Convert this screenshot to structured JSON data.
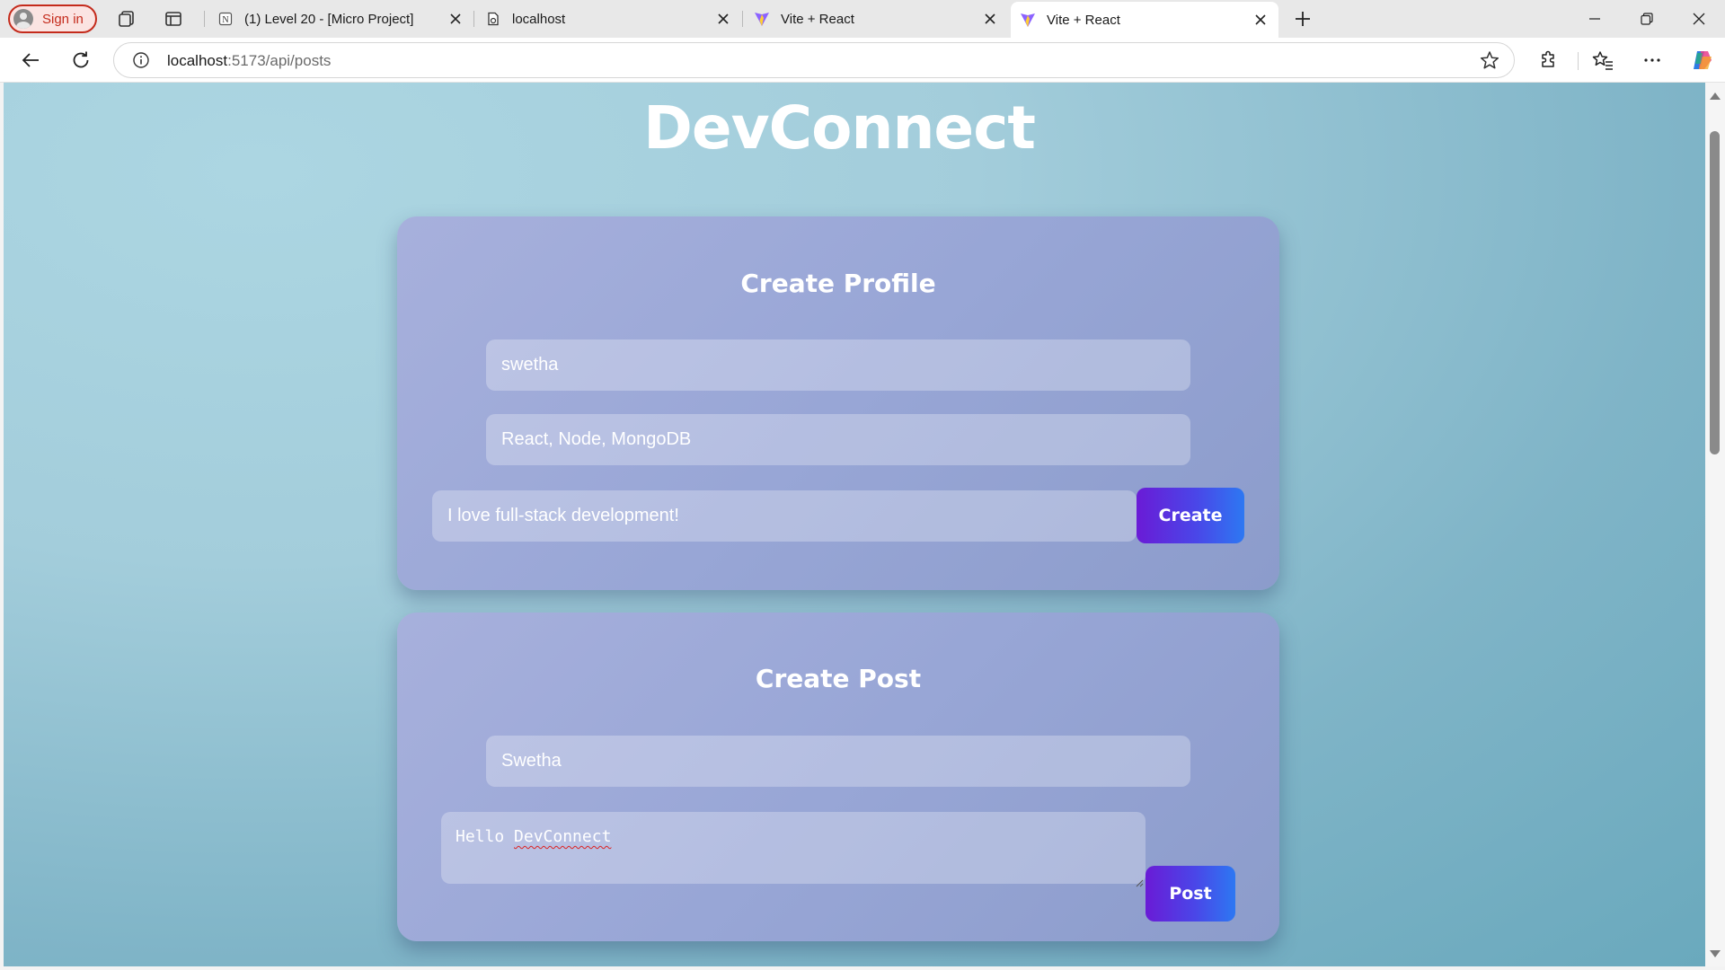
{
  "browser": {
    "signin_label": "Sign in",
    "tabs": [
      {
        "title": "(1) Level 20 - [Micro Project]",
        "favicon": "notion-icon"
      },
      {
        "title": "localhost",
        "favicon": "page-icon"
      },
      {
        "title": "Vite + React",
        "favicon": "vite-icon"
      },
      {
        "title": "Vite + React",
        "favicon": "vite-icon",
        "active": true
      }
    ],
    "url_host": "localhost",
    "url_path": ":5173/api/posts"
  },
  "page": {
    "brand": "DevConnect",
    "profile": {
      "heading": "Create Profile",
      "name_value": "swetha",
      "skills_value": "React, Node, MongoDB",
      "bio_value": "I love full-stack development!",
      "create_label": "Create"
    },
    "post": {
      "heading": "Create Post",
      "author_value": "Swetha",
      "content_word1": "Hello ",
      "content_word2": "DevConnect",
      "post_label": "Post"
    }
  },
  "colors": {
    "brand_accent": "#6a1bd6",
    "button_end": "#2d78f2",
    "signin_red": "#c42b1c"
  }
}
